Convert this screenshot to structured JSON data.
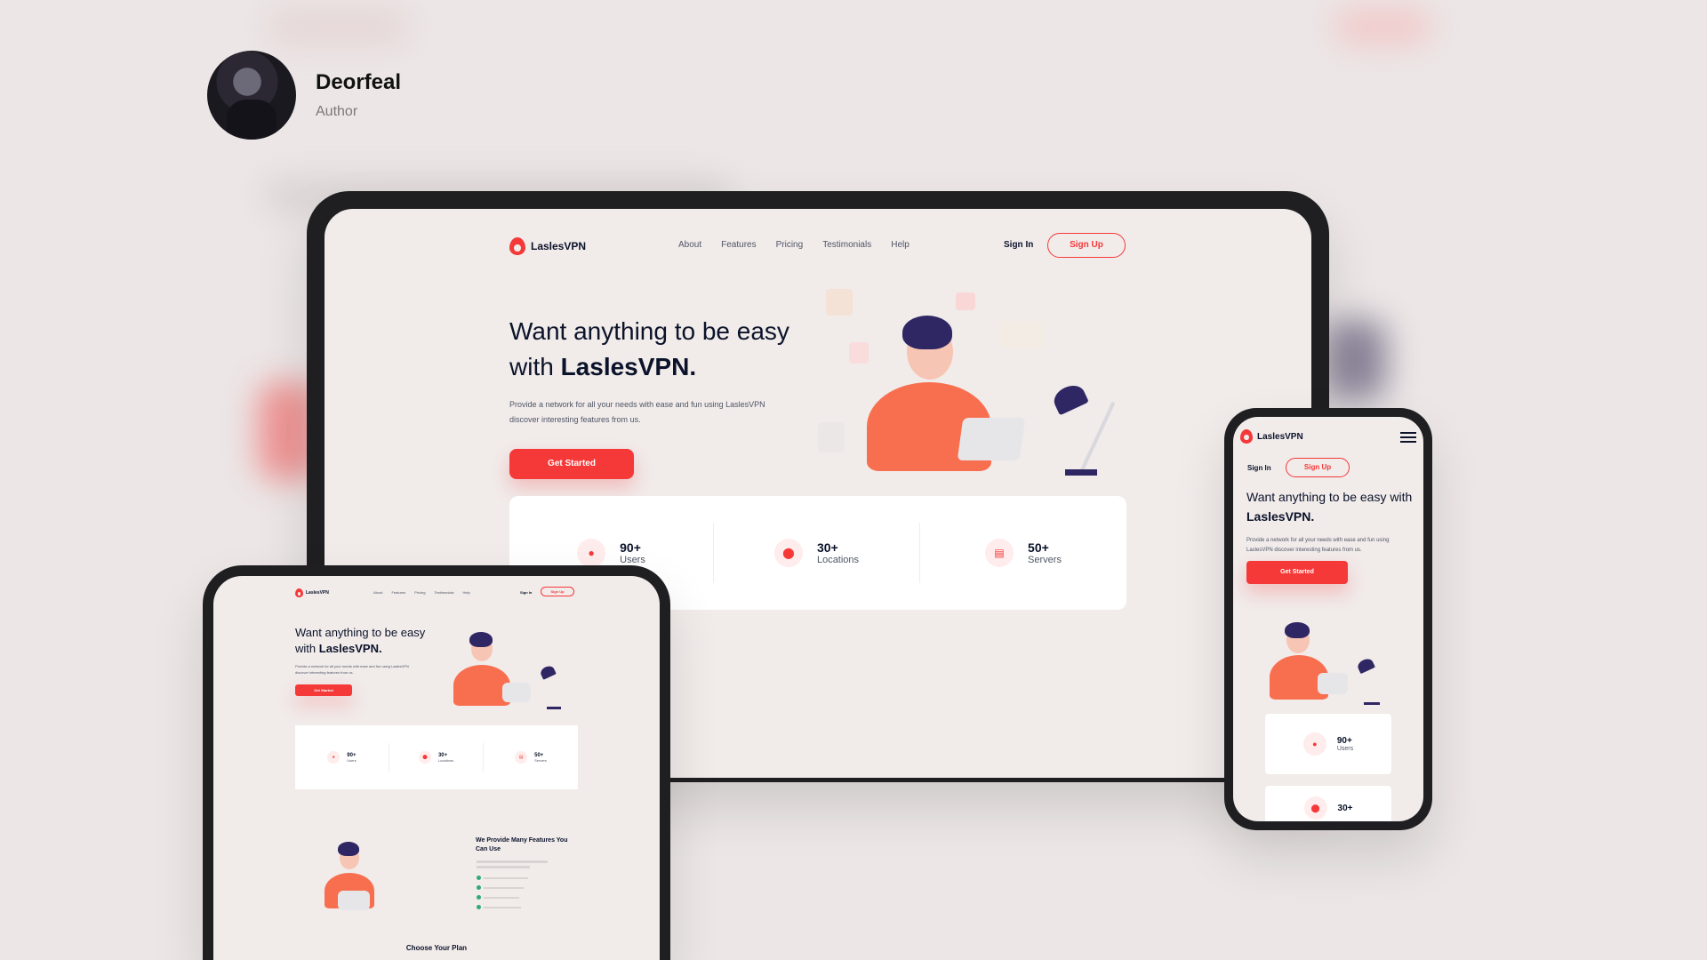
{
  "author": {
    "name": "Deorfeal",
    "role": "Author"
  },
  "site": {
    "brand": "LaslesVPN",
    "nav": [
      "About",
      "Features",
      "Pricing",
      "Testimonials",
      "Help"
    ],
    "sign_in": "Sign In",
    "sign_up": "Sign Up",
    "hero_title_part1": "Want anything to be easy with",
    "hero_title_brand": "LaslesVPN.",
    "hero_desc": "Provide a network for all your needs with ease and fun using LaslesVPN discover interesting features from us.",
    "cta": "Get Started",
    "stats": [
      {
        "num": "90+",
        "label": "Users",
        "icon": "user-icon"
      },
      {
        "num": "30+",
        "label": "Locations",
        "icon": "location-icon"
      },
      {
        "num": "50+",
        "label": "Servers",
        "icon": "server-icon"
      }
    ],
    "features_title": "We Provide Many Features You Can Use",
    "plan_title": "Choose Your Plan"
  },
  "colors": {
    "accent": "#f53838",
    "dark": "#0b132a",
    "bg": "#ece6e6"
  }
}
